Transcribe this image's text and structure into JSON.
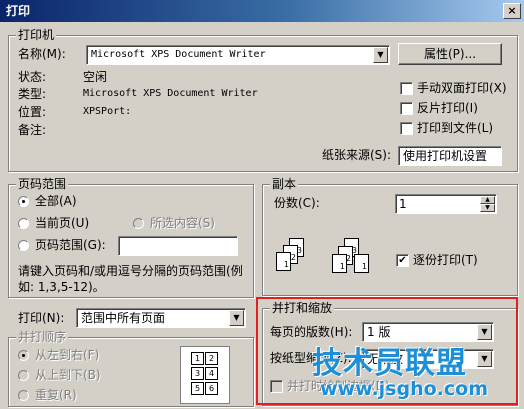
{
  "window": {
    "title": "打印",
    "close_glyph": "×"
  },
  "printer": {
    "legend": "打印机",
    "name_label": "名称(M):",
    "name_value": "Microsoft XPS Document Writer",
    "properties_button": "属性(P)...",
    "status_label": "状态:",
    "status_value": "空闲",
    "type_label": "类型:",
    "type_value": "Microsoft XPS Document Writer",
    "location_label": "位置:",
    "location_value": "XPSPort:",
    "comment_label": "备注:",
    "comment_value": "",
    "manual_duplex": "手动双面打印(X)",
    "reverse_print": "反片打印(I)",
    "print_to_file": "打印到文件(L)",
    "paper_source_label": "纸张来源(S):",
    "paper_source_value": "使用打印机设置"
  },
  "page_range": {
    "legend": "页码范围",
    "all": "全部(A)",
    "current_page": "当前页(U)",
    "selection": "所选内容(S)",
    "pages": "页码范围(G):",
    "pages_value": "",
    "hint": "请键入页码和/或用逗号分隔的页码范围(例如: 1,3,5-12)。"
  },
  "print_what": {
    "label": "打印(N):",
    "value": "范围中所有页面"
  },
  "order": {
    "legend": "并打顺序",
    "left_to_right": "从左到右(F)",
    "top_to_bottom": "从上到下(B)",
    "repeat": "重复(R)",
    "cells": [
      "1",
      "2",
      "3",
      "4",
      "5",
      "6"
    ]
  },
  "copies": {
    "legend": "副本",
    "count_label": "份数(C):",
    "count_value": "1",
    "collate": "逐份打印(T)",
    "stack_pages": [
      "1",
      "2",
      "3"
    ]
  },
  "zoom": {
    "legend": "并打和缩放",
    "pages_per_sheet_label": "每页的版数(H):",
    "pages_per_sheet_value": "1 版",
    "scale_label": "按纸型缩放(Z):",
    "scale_value": "无缩放",
    "draw_borders": "并打时绘制边框(D)"
  },
  "watermark": {
    "line1": "技术员联盟",
    "line2": "www.jsgho.com"
  },
  "colors": {
    "highlight": "#e02020",
    "title_start": "#0a246a",
    "title_end": "#a6caf0",
    "watermark": "#1d8fd8"
  }
}
